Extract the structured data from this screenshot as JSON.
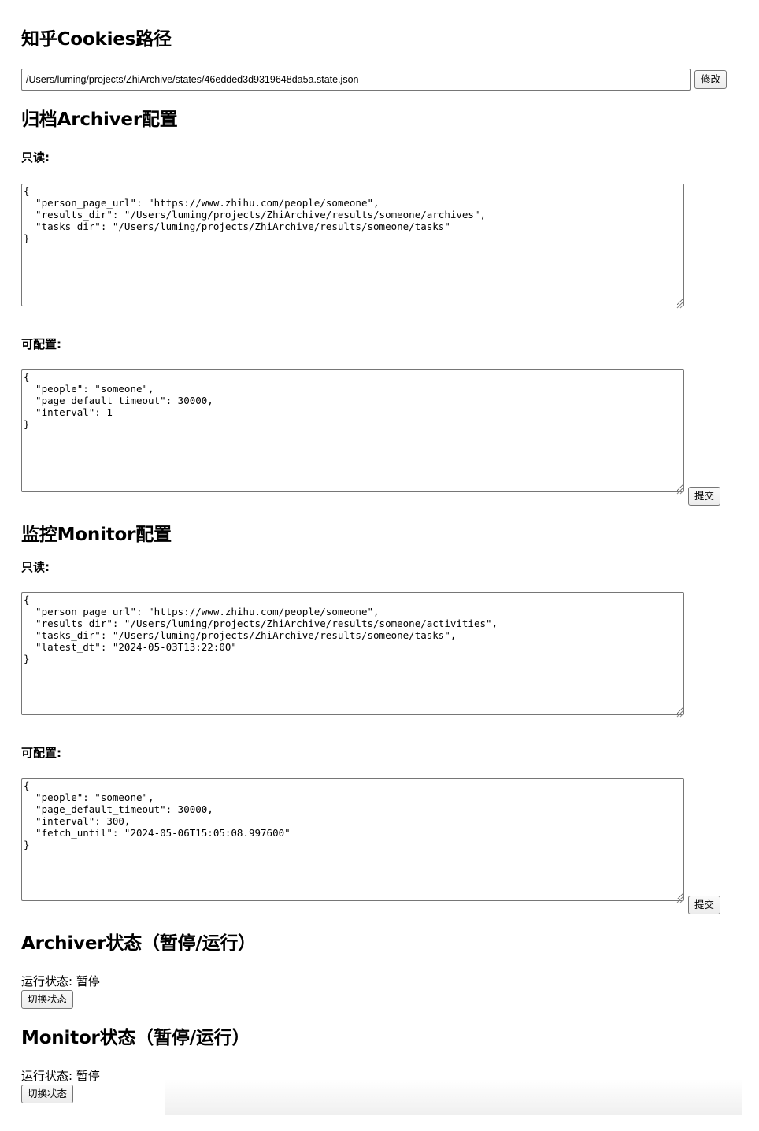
{
  "cookies": {
    "heading": "知乎Cookies路径",
    "path_value": "/Users/luming/projects/ZhiArchive/states/46edded3d9319648da5a.state.json",
    "modify_button": "修改"
  },
  "archiver_config": {
    "heading": "归档Archiver配置",
    "readonly_label": "只读:",
    "readonly_json": "{\n  \"person_page_url\": \"https://www.zhihu.com/people/someone\",\n  \"results_dir\": \"/Users/luming/projects/ZhiArchive/results/someone/archives\",\n  \"tasks_dir\": \"/Users/luming/projects/ZhiArchive/results/someone/tasks\"\n}",
    "configurable_label": "可配置:",
    "configurable_json": "{\n  \"people\": \"someone\",\n  \"page_default_timeout\": 30000,\n  \"interval\": 1\n}",
    "submit_button": "提交"
  },
  "monitor_config": {
    "heading": "监控Monitor配置",
    "readonly_label": "只读:",
    "readonly_json": "{\n  \"person_page_url\": \"https://www.zhihu.com/people/someone\",\n  \"results_dir\": \"/Users/luming/projects/ZhiArchive/results/someone/activities\",\n  \"tasks_dir\": \"/Users/luming/projects/ZhiArchive/results/someone/tasks\",\n  \"latest_dt\": \"2024-05-03T13:22:00\"\n}",
    "configurable_label": "可配置:",
    "configurable_json": "{\n  \"people\": \"someone\",\n  \"page_default_timeout\": 30000,\n  \"interval\": 300,\n  \"fetch_until\": \"2024-05-06T15:05:08.997600\"\n}",
    "submit_button": "提交"
  },
  "archiver_status": {
    "heading": "Archiver状态（暂停/运行）",
    "status_text": "运行状态: 暂停",
    "toggle_button": "切换状态"
  },
  "monitor_status": {
    "heading": "Monitor状态（暂停/运行）",
    "status_text": "运行状态: 暂停",
    "toggle_button": "切换状态"
  }
}
